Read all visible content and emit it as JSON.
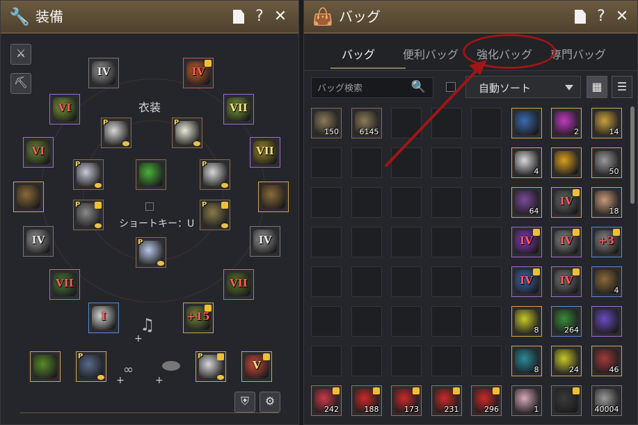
{
  "equipment": {
    "title": "装備",
    "costume_label": "衣装",
    "shortcut_label": "ショートキー：U",
    "controls": {
      "doc": "document",
      "help": "?",
      "close": "✕"
    },
    "slots": [
      {
        "id": "helm-accent",
        "roman": "IV",
        "roman_color": "white",
        "border": "grey",
        "art": "#9a9a9a"
      },
      {
        "id": "top-right",
        "roman": "IV",
        "roman_color": "red",
        "border": "red",
        "art": "#c8602a",
        "lock": true
      },
      {
        "id": "left-1",
        "roman": "VI",
        "roman_color": "red",
        "border": "purple",
        "art": "#7a9a3a"
      },
      {
        "id": "right-1",
        "roman": "VII",
        "roman_color": "gold",
        "border": "purple",
        "art": "#7a9a3a"
      },
      {
        "id": "left-2",
        "roman": "VI",
        "roman_color": "red",
        "border": "purple",
        "art": "#6a8a3a"
      },
      {
        "id": "right-2",
        "roman": "VII",
        "roman_color": "gold",
        "border": "purple",
        "art": "#a08a2a"
      },
      {
        "id": "left-3",
        "roman": "",
        "border": "gold",
        "art": "#8a6a3a"
      },
      {
        "id": "right-3",
        "roman": "",
        "border": "gold",
        "art": "#8a6a3a"
      },
      {
        "id": "left-4",
        "roman": "IV",
        "roman_color": "white",
        "border": "grey",
        "art": "#9a9a9a"
      },
      {
        "id": "right-4",
        "roman": "IV",
        "roman_color": "white",
        "border": "grey",
        "art": "#9a9a9a"
      },
      {
        "id": "left-5",
        "roman": "VII",
        "roman_color": "red",
        "border": "purple",
        "art": "#4a7a3a"
      },
      {
        "id": "right-5",
        "roman": "VII",
        "roman_color": "red",
        "border": "purple",
        "art": "#5a7a2a"
      },
      {
        "id": "weapon-main",
        "roman": "I",
        "roman_color": "red",
        "border": "blue",
        "art": "#d8d8d8"
      },
      {
        "id": "weapon-awaken",
        "roman": "+15",
        "roman_color": "red",
        "border": "gold",
        "art": "#7a8a3a",
        "lock": true
      }
    ],
    "costume_slots": [
      {
        "id": "c-hat",
        "p": "P",
        "art": "#d8d8d8",
        "coin": true
      },
      {
        "id": "c-hood",
        "p": "P",
        "art": "#e8e8d8",
        "coin": true
      },
      {
        "id": "c-legs",
        "p": "P",
        "art": "#c8c8d8",
        "coin": true
      },
      {
        "id": "c-gem",
        "art": "#4ab03a"
      },
      {
        "id": "c-outfit",
        "p": "P",
        "art": "#d8d8d8",
        "coin": true
      },
      {
        "id": "c-gun-left",
        "p": "P",
        "art": "#8a8a8a",
        "lock": true,
        "coin": true
      },
      {
        "id": "c-gun-right",
        "p": "P",
        "art": "#8a7a4a",
        "lock": true,
        "coin": true
      },
      {
        "id": "c-pants",
        "p": "P",
        "art": "#b8c8e8",
        "coin": true
      }
    ],
    "bottom_slots": [
      {
        "id": "b-book",
        "border": "gold",
        "art": "#5a8a2a"
      },
      {
        "id": "b-emblem",
        "p": "P",
        "border": "gold",
        "art": "#5a6a8a",
        "coin": true
      },
      {
        "id": "b-pet",
        "p": "P",
        "border": "gold",
        "art": "#d8d8d8",
        "lock": true,
        "coin": true
      },
      {
        "id": "b-fx",
        "roman": "V",
        "roman_color": "gold",
        "border": "gold",
        "art": "#c84a3a",
        "lock": true
      }
    ]
  },
  "bag": {
    "title": "バッグ",
    "tabs": [
      "バッグ",
      "便利バッグ",
      "強化バッグ",
      "専門バッグ"
    ],
    "search_placeholder": "バッグ検索",
    "sort_label": "自動ソート",
    "items": [
      {
        "art": "#8a7a5a",
        "count": "150"
      },
      {
        "art": "#8a7a5a",
        "count": "6145"
      },
      {},
      {},
      {},
      {
        "art": "#3a6ab0",
        "border": "gold"
      },
      {
        "art": "#c03ac0",
        "count": "2",
        "border": "gold"
      },
      {
        "art": "#c8a040",
        "count": "14",
        "border": "gold"
      },
      {},
      {},
      {},
      {},
      {},
      {
        "art": "#d8d8d8",
        "count": "4",
        "border": "gold"
      },
      {
        "art": "#d8a020",
        "border": "gold"
      },
      {
        "art": "#9a9a9a",
        "count": "50",
        "border": "gold"
      },
      {},
      {},
      {},
      {},
      {},
      {
        "art": "#7a4a9a",
        "count": "64",
        "border": "gold"
      },
      {
        "art": "#6a6a6a",
        "roman": "IV",
        "roman_color": "red",
        "lock": true,
        "border": "gold"
      },
      {
        "art": "#c89a7a",
        "count": "18",
        "border": "gold"
      },
      {},
      {},
      {},
      {},
      {},
      {
        "art": "#8a3ac0",
        "roman": "IV",
        "roman_color": "red",
        "lock": true,
        "border": "purple"
      },
      {
        "art": "#8a8a8a",
        "roman": "IV",
        "roman_color": "red",
        "lock": true,
        "border": "purple"
      },
      {
        "art": "#8a8a8a",
        "roman": "+3",
        "roman_color": "red",
        "lock": true,
        "border": "blue"
      },
      {},
      {},
      {},
      {},
      {},
      {
        "art": "#3a6ab0",
        "roman": "IV",
        "roman_color": "red",
        "lock": true,
        "border": "purple"
      },
      {
        "art": "#7a7a7a",
        "roman": "IV",
        "roman_color": "red",
        "lock": true,
        "border": "purple"
      },
      {
        "art": "#8a6a3a",
        "count": "4",
        "border": "blue"
      },
      {},
      {},
      {},
      {},
      {},
      {
        "art": "#c8c82a",
        "count": "8",
        "border": "gold"
      },
      {
        "art": "#3a8a3a",
        "count": "264",
        "border": "blue"
      },
      {
        "art": "#6a4ac0",
        "border": "purple"
      },
      {},
      {},
      {},
      {},
      {},
      {
        "art": "#2a8a9a",
        "count": "8",
        "border": "gold"
      },
      {
        "art": "#c8c82a",
        "count": "24",
        "border": "gold"
      },
      {
        "art": "#a03a3a",
        "count": "46",
        "border": "gold"
      },
      {
        "art": "#c83a4a",
        "count": "242",
        "border": "red",
        "lock": true
      },
      {
        "art": "#c82a2a",
        "count": "188",
        "border": "red",
        "lock": true
      },
      {
        "art": "#c82a2a",
        "count": "173",
        "border": "red",
        "lock": true
      },
      {
        "art": "#c82a2a",
        "count": "231",
        "border": "red",
        "lock": true
      },
      {
        "art": "#c82a2a",
        "count": "296",
        "border": "red",
        "lock": true
      },
      {
        "art": "#d8a8b8",
        "count": "1",
        "border": "grey"
      },
      {
        "art": "#3a3a3a",
        "border": "grey",
        "lock": true
      },
      {
        "art": "#9a9a9a",
        "count": "40004",
        "border": "grey"
      }
    ]
  }
}
